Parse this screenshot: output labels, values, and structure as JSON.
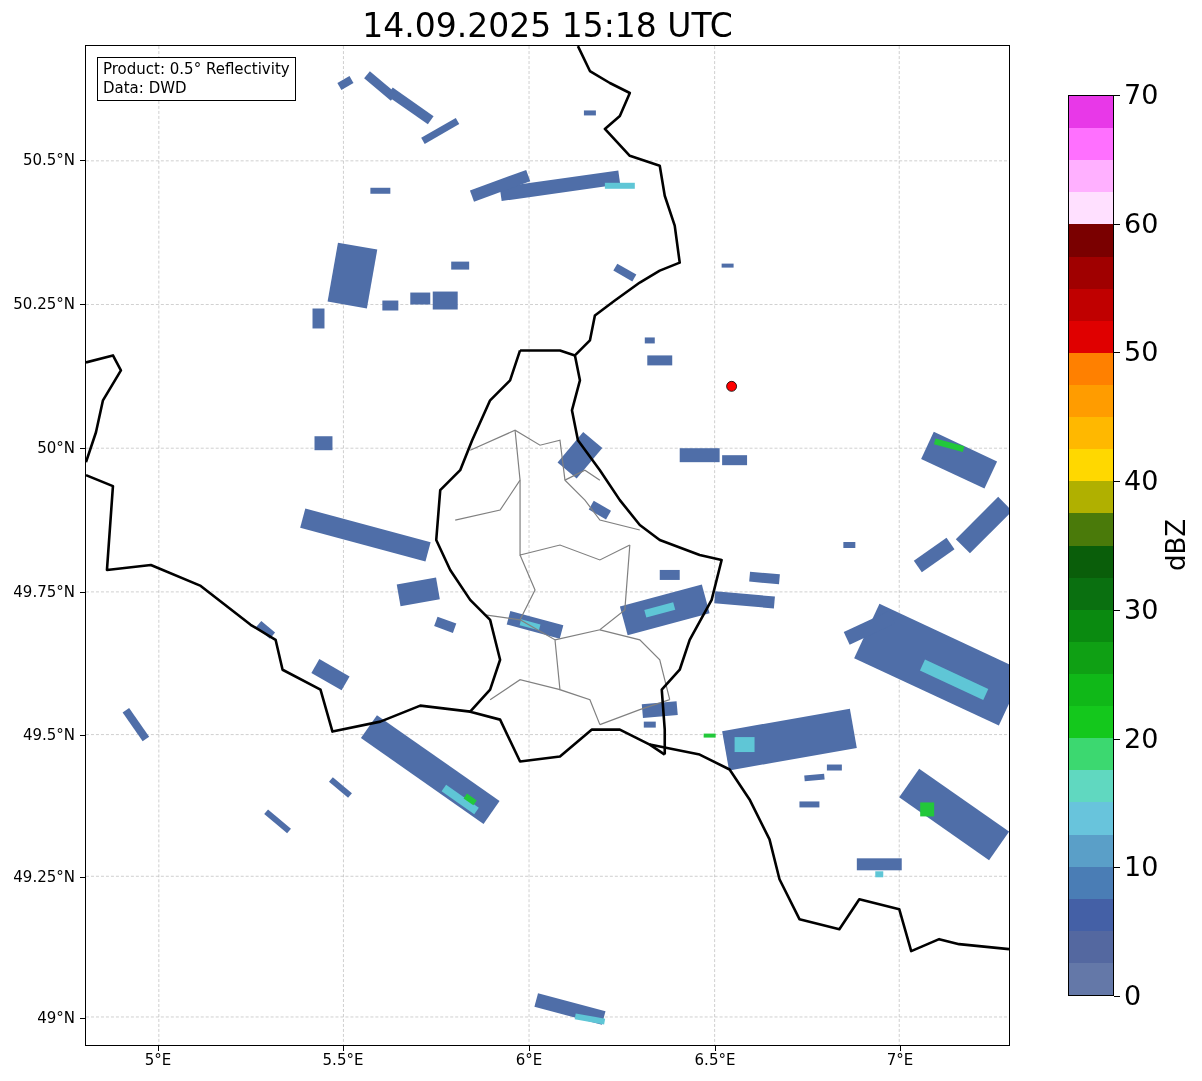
{
  "title": "14.09.2025 15:18 UTC",
  "info_box": [
    "Product: 0.5° Reflectivity",
    "Data: DWD"
  ],
  "y_ticks": [
    "50.5°N",
    "50.25°N",
    "50°N",
    "49.75°N",
    "49.5°N",
    "49.25°N",
    "49°N"
  ],
  "x_ticks": [
    "5°E",
    "5.5°E",
    "6°E",
    "6.5°E",
    "7°E"
  ],
  "colorbar": {
    "label": "dBZ",
    "ticks": [
      "70",
      "60",
      "50",
      "40",
      "30",
      "20",
      "10",
      "0"
    ],
    "segments": [
      {
        "color": "#e838e8"
      },
      {
        "color": "#ff70ff"
      },
      {
        "color": "#ffb0ff"
      },
      {
        "color": "#ffe0ff"
      },
      {
        "color": "#7a0000"
      },
      {
        "color": "#a00000"
      },
      {
        "color": "#c00000"
      },
      {
        "color": "#e00000"
      },
      {
        "color": "#ff8000"
      },
      {
        "color": "#ff9c00"
      },
      {
        "color": "#ffb800"
      },
      {
        "color": "#ffd800"
      },
      {
        "color": "#b0b000"
      },
      {
        "color": "#4a7a0a"
      },
      {
        "color": "#0a5e0a"
      },
      {
        "color": "#0a7010"
      },
      {
        "color": "#0a8a10"
      },
      {
        "color": "#0fa014"
      },
      {
        "color": "#10b818"
      },
      {
        "color": "#14c81c"
      },
      {
        "color": "#3cd870"
      },
      {
        "color": "#60d8c0"
      },
      {
        "color": "#68c4dc"
      },
      {
        "color": "#5a9fc8"
      },
      {
        "color": "#4a7db5"
      },
      {
        "color": "#4460a6"
      },
      {
        "color": "#5468a0"
      },
      {
        "color": "#6478a8"
      }
    ]
  }
}
